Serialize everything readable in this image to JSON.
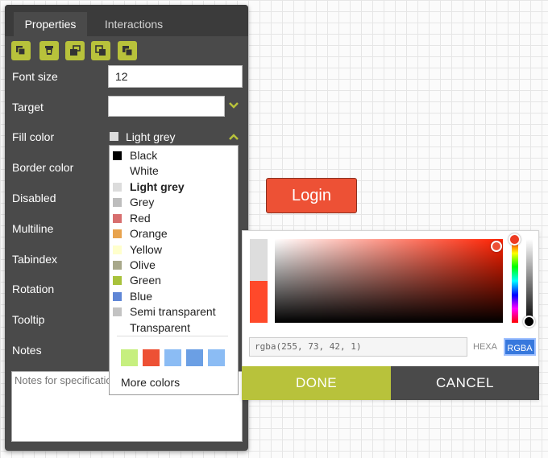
{
  "tabs": {
    "properties": "Properties",
    "interactions": "Interactions"
  },
  "toolbar": {
    "buttons": [
      "bring-to-front-icon",
      "lock-icon",
      "unlock-icon",
      "copy-icon",
      "paste-style-icon"
    ],
    "accent_color": "#b8c23b"
  },
  "fields": {
    "font_size": {
      "label": "Font size",
      "value": "12"
    },
    "target": {
      "label": "Target",
      "value": ""
    },
    "fill_color": {
      "label": "Fill color",
      "value": "Light grey"
    },
    "border_color": {
      "label": "Border color"
    },
    "disabled": {
      "label": "Disabled"
    },
    "multiline": {
      "label": "Multiline"
    },
    "tabindex": {
      "label": "Tabindex"
    },
    "rotation": {
      "label": "Rotation"
    },
    "tooltip": {
      "label": "Tooltip"
    },
    "notes": {
      "label": "Notes",
      "placeholder": "Notes for specification"
    }
  },
  "color_dropdown": {
    "options": [
      {
        "label": "Black",
        "color": "#000000"
      },
      {
        "label": "White",
        "color": "#ffffff"
      },
      {
        "label": "Light grey",
        "color": "#dcdcdc",
        "selected": true
      },
      {
        "label": "Grey",
        "color": "#bdbdbd"
      },
      {
        "label": "Red",
        "color": "#d76e6e"
      },
      {
        "label": "Orange",
        "color": "#e8a34e"
      },
      {
        "label": "Yellow",
        "color": "#ffffcc"
      },
      {
        "label": "Olive",
        "color": "#a8a88a"
      },
      {
        "label": "Green",
        "color": "#a8c23b"
      },
      {
        "label": "Blue",
        "color": "#5f86d6"
      },
      {
        "label": "Semi transparent",
        "color": "#c3c3c3"
      },
      {
        "label": "Transparent",
        "color": "transparent"
      }
    ],
    "recent_colors": [
      "#c6ef7f",
      "#ed5135",
      "#8bbcf4",
      "#6b9fe4",
      "#8bbcf4"
    ],
    "more_label": "More colors"
  },
  "login_button": {
    "label": "Login",
    "color": "#ed5135"
  },
  "picker": {
    "value": "rgba(255, 73, 42, 1)",
    "modes": [
      "HEXA",
      "RGBA"
    ],
    "active_mode": "RGBA",
    "done_label": "DONE",
    "cancel_label": "CANCEL"
  }
}
